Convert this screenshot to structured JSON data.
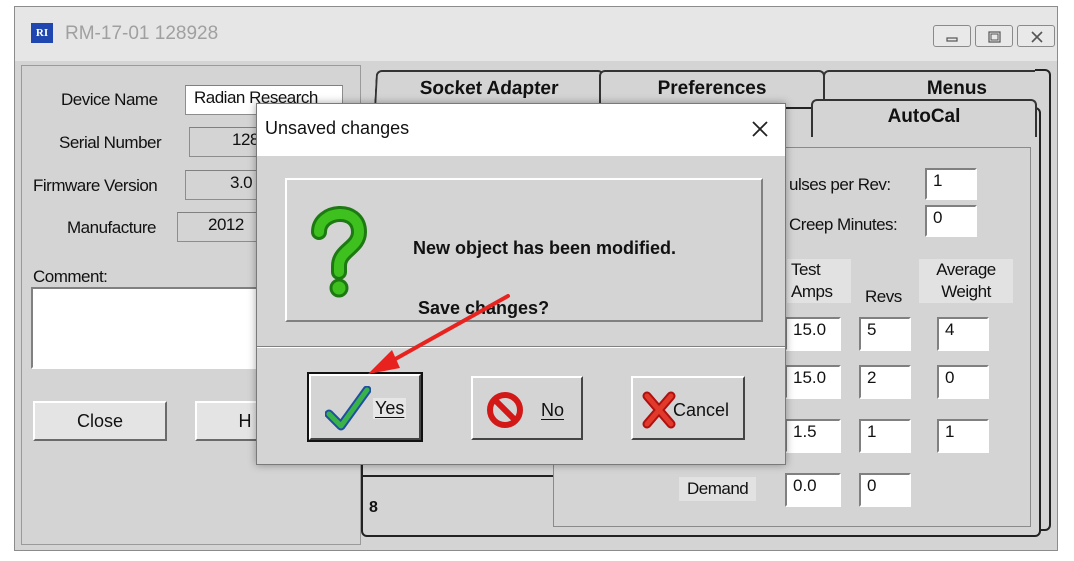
{
  "window": {
    "title": "RM-17-01 128928",
    "app_icon_text": "RI",
    "controls": [
      "minimize-icon",
      "restore-icon",
      "close-icon"
    ]
  },
  "device_info": {
    "device_name_label": "Device Name",
    "device_name_value": "Radian Research",
    "serial_number_label": "Serial Number",
    "serial_number_value": "128",
    "firmware_label": "Firmware Version",
    "firmware_value": "3.0",
    "manufacture_label": "Manufacture",
    "manufacture_value": "2012",
    "comment_label": "Comment:",
    "comment_value": ""
  },
  "footer_buttons": {
    "close_label": "Close",
    "help_label": "H"
  },
  "tabs": {
    "back_row": [
      "Socket Adapter",
      "Preferences",
      "Menus"
    ],
    "front_row": [
      "AutoCal"
    ]
  },
  "autocal": {
    "pulses_label": "ulses per Rev:",
    "pulses_value": "1",
    "creep_label": "Creep Minutes:",
    "creep_value": "0",
    "col_test_amps": "Test\nAmps",
    "col_revs": "Revs",
    "col_avg_weight": "Average\nWeight",
    "rows": [
      {
        "amps": "15.0",
        "revs": "5",
        "weight": "4"
      },
      {
        "amps": "15.0",
        "revs": "2",
        "weight": "0"
      },
      {
        "amps": "1.5",
        "revs": "1",
        "weight": "1"
      },
      {
        "label": "Demand",
        "amps": "0.0",
        "revs": "0"
      }
    ],
    "left_list_fragment": "8"
  },
  "dialog": {
    "title": "Unsaved changes",
    "message_line1": "New object has been modified.",
    "message_line2": " Save changes?",
    "icon": "question-icon",
    "yes_label": "Yes",
    "no_label": "No",
    "cancel_label": "Cancel",
    "accent_green": "#2a9a1a",
    "annotation_arrow_color": "#e8231f"
  }
}
